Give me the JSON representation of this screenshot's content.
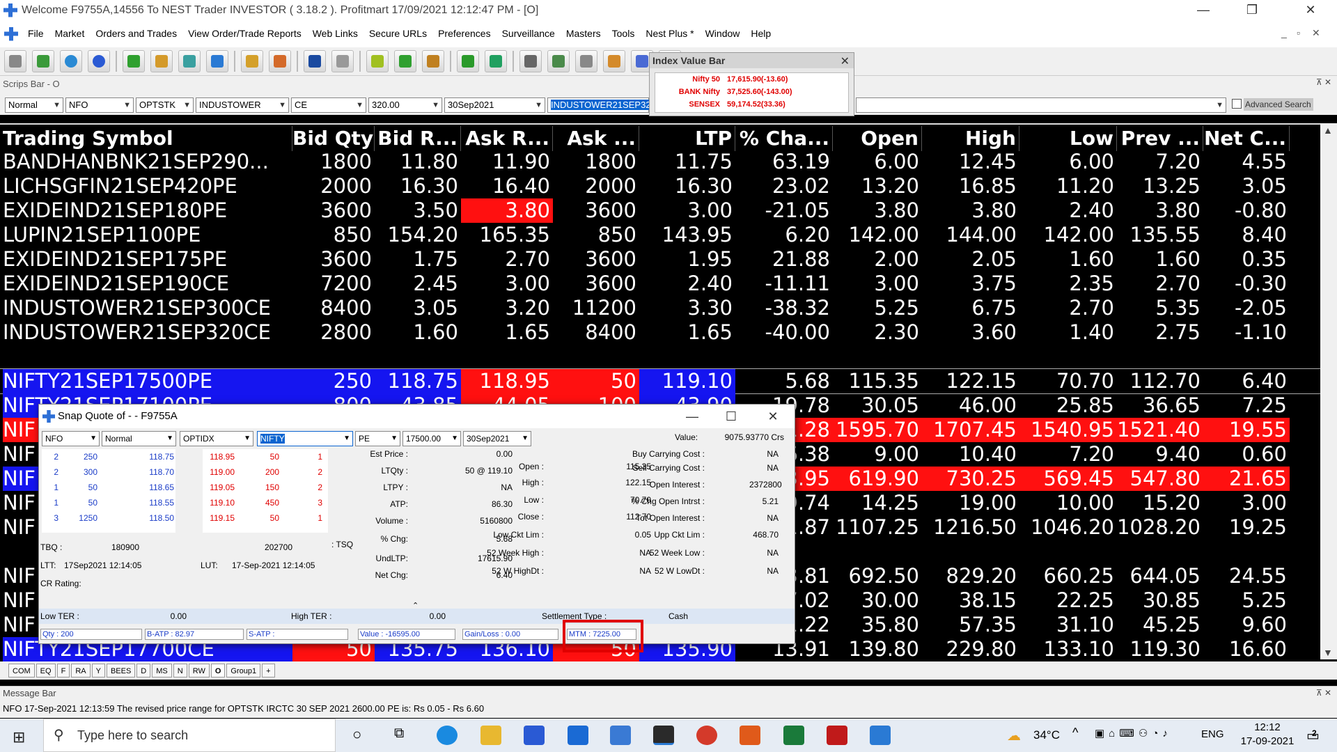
{
  "window": {
    "title": "Welcome F9755A,14556 To NEST Trader INVESTOR ( 3.18.2 ).  Profitmart  17/09/2021 12:12:47 PM - [O]",
    "minimize": "—",
    "restore": "❐",
    "close": "✕"
  },
  "menu": [
    "File",
    "Market",
    "Orders and Trades",
    "View Order/Trade Reports",
    "Web Links",
    "Secure URLs",
    "Preferences",
    "Surveillance",
    "Masters",
    "Tools",
    "Nest Plus *",
    "Window",
    "Help"
  ],
  "mdi_controls": {
    "minimize": "_",
    "restore": "▫",
    "close": "✕"
  },
  "index_value_bar": {
    "title": "Index Value Bar",
    "close": "✕",
    "rows": [
      {
        "name": "Nifty 50",
        "value": "17,615.90(-13.60)"
      },
      {
        "name": "BANK Nifty",
        "value": "37,525.60(-143.00)"
      },
      {
        "name": "SENSEX",
        "value": "59,174.52(33.36)"
      }
    ]
  },
  "scrips_bar": {
    "label": "Scrips Bar - O",
    "pin": "⊼ ✕",
    "fields": [
      "Normal",
      "NFO",
      "OPTSTK",
      "INDUSTOWER",
      "CE",
      "320.00",
      "30Sep2021",
      "INDUSTOWER21SEP320C",
      ""
    ],
    "advanced_search": "Advanced Search"
  },
  "grid": {
    "headers": [
      "Trading Symbol",
      "Bid Qty",
      "Bid R...",
      "Ask R...",
      "Ask ...",
      "LTP",
      "% Cha...",
      "Open",
      "High",
      "Low",
      "Prev ...",
      "Net C..."
    ],
    "rows": [
      [
        "BANDHANBNK21SEP290...",
        "1800",
        "11.80",
        "11.90",
        "1800",
        "11.75",
        "63.19",
        "6.00",
        "12.45",
        "6.00",
        "7.20",
        "4.55"
      ],
      [
        "LICHSGFIN21SEP420PE",
        "2000",
        "16.30",
        "16.40",
        "2000",
        "16.30",
        "23.02",
        "13.20",
        "16.85",
        "11.20",
        "13.25",
        "3.05"
      ],
      [
        "EXIDEIND21SEP180PE",
        "3600",
        "3.50",
        "3.80",
        "3600",
        "3.00",
        "-21.05",
        "3.80",
        "3.80",
        "2.40",
        "3.80",
        "-0.80"
      ],
      [
        "LUPIN21SEP1100PE",
        "850",
        "154.20",
        "165.35",
        "850",
        "143.95",
        "6.20",
        "142.00",
        "144.00",
        "142.00",
        "135.55",
        "8.40"
      ],
      [
        "EXIDEIND21SEP175PE",
        "3600",
        "1.75",
        "2.70",
        "3600",
        "1.95",
        "21.88",
        "2.00",
        "2.05",
        "1.60",
        "1.60",
        "0.35"
      ],
      [
        "EXIDEIND21SEP190CE",
        "7200",
        "2.45",
        "3.00",
        "3600",
        "2.40",
        "-11.11",
        "3.00",
        "3.75",
        "2.35",
        "2.70",
        "-0.30"
      ],
      [
        "INDUSTOWER21SEP300CE",
        "8400",
        "3.05",
        "3.20",
        "11200",
        "3.30",
        "-38.32",
        "5.25",
        "6.75",
        "2.70",
        "5.35",
        "-2.05"
      ],
      [
        "INDUSTOWER21SEP320CE",
        "2800",
        "1.60",
        "1.65",
        "8400",
        "1.65",
        "-40.00",
        "2.30",
        "3.60",
        "1.40",
        "2.75",
        "-1.10"
      ],
      [
        "",
        "",
        "",
        "",
        "",
        "",
        "",
        "",
        "",
        "",
        "",
        ""
      ],
      [
        "NIFTY21SEP17500PE",
        "250",
        "118.75",
        "118.95",
        "50",
        "119.10",
        "5.68",
        "115.35",
        "122.15",
        "70.70",
        "112.70",
        "6.40"
      ],
      [
        "NIFTY21SEP17100PE",
        "800",
        "43.85",
        "44.05",
        "100",
        "43.90",
        "19.78",
        "30.05",
        "46.00",
        "25.85",
        "36.65",
        "7.25"
      ],
      [
        "NIF",
        "",
        "",
        "",
        "",
        "",
        "1.28",
        "1595.70",
        "1707.45",
        "1540.95",
        "1521.40",
        "19.55"
      ],
      [
        "NIF",
        "",
        "",
        "",
        "",
        "",
        "6.38",
        "9.00",
        "10.40",
        "7.20",
        "9.40",
        "0.60"
      ],
      [
        "NIF",
        "",
        "",
        "",
        "",
        "",
        "3.95",
        "619.90",
        "730.25",
        "569.45",
        "547.80",
        "21.65"
      ],
      [
        "NIF",
        "",
        "",
        "",
        "",
        "",
        "9.74",
        "14.25",
        "19.00",
        "10.00",
        "15.20",
        "3.00"
      ],
      [
        "NIF",
        "",
        "",
        "",
        "",
        "",
        "1.87",
        "1107.25",
        "1216.50",
        "1046.20",
        "1028.20",
        "19.25"
      ],
      [
        "",
        "",
        "",
        "",
        "",
        "",
        "",
        "",
        "",
        "",
        "",
        ""
      ],
      [
        "NIF",
        "",
        "",
        "",
        "",
        "",
        "3.81",
        "692.50",
        "829.20",
        "660.25",
        "644.05",
        "24.55"
      ],
      [
        "NIF",
        "",
        "",
        "",
        "",
        "",
        "7.02",
        "30.00",
        "38.15",
        "22.25",
        "30.85",
        "5.25"
      ],
      [
        "NIF",
        "",
        "",
        "",
        "",
        "",
        "1.22",
        "35.80",
        "57.35",
        "31.10",
        "45.25",
        "9.60"
      ],
      [
        "NIFTY21SEP17700CE",
        "50",
        "135.75",
        "136.10",
        "50",
        "135.90",
        "13.91",
        "139.80",
        "229.80",
        "133.10",
        "119.30",
        "16.60"
      ]
    ],
    "colors": {
      "blue": "#1515f0",
      "red": "#ff1010",
      "white": "#ffffff"
    }
  },
  "tabs": [
    "COM",
    "EQ",
    "F",
    "RA",
    "Y",
    "BEES",
    "D",
    "MS",
    "N",
    "RW",
    "O",
    "Group1",
    "+"
  ],
  "message_bar": {
    "label": "Message Bar",
    "text": "NFO 17-Sep-2021 12:13:59 The revised price range for OPTSTK IRCTC 30 SEP 2021 2600.00 PE is: Rs 0.05 - Rs 6.60"
  },
  "snap_quote": {
    "title": "Snap Quote of  -  - F9755A",
    "minimize": "—",
    "maximize": "☐",
    "close": "✕",
    "selectors": [
      "NFO",
      "Normal",
      "OPTIDX",
      "NIFTY",
      "PE",
      "17500.00",
      "30Sep2021"
    ],
    "value_label": "Value:",
    "value": "9075.93770 Crs",
    "bid_depth": [
      [
        "2",
        "250",
        "118.75"
      ],
      [
        "2",
        "300",
        "118.70"
      ],
      [
        "1",
        "50",
        "118.65"
      ],
      [
        "1",
        "50",
        "118.55"
      ],
      [
        "3",
        "1250",
        "118.50"
      ]
    ],
    "ask_depth": [
      [
        "118.95",
        "50",
        "1"
      ],
      [
        "119.00",
        "200",
        "2"
      ],
      [
        "119.05",
        "150",
        "2"
      ],
      [
        "119.10",
        "450",
        "3"
      ],
      [
        "119.15",
        "50",
        "1"
      ]
    ],
    "tbq_label": "TBQ :",
    "tbq": "180900",
    "tsq": "202700",
    "tsq_label": ": TSQ",
    "ltt_label": "LTT:",
    "ltt": "17Sep2021 12:14:05",
    "lut_label": "LUT:",
    "lut": "17-Sep-2021 12:14:05",
    "cr_rating_label": "CR Rating:",
    "left_stats": [
      [
        "Est Price :",
        "0.00"
      ],
      [
        "LTQty :",
        "50 @ 119.10"
      ],
      [
        "LTPY :",
        "NA"
      ],
      [
        "ATP:",
        "86.30"
      ],
      [
        "Volume :",
        "5160800"
      ],
      [
        "% Chg:",
        "5.68"
      ],
      [
        "UndLTP:",
        "17615.90"
      ],
      [
        "Net Chg:",
        "6.40"
      ]
    ],
    "mid_stats": [
      [
        "Open :",
        "115.35"
      ],
      [
        "High :",
        "122.15"
      ],
      [
        "Low :",
        "70.70"
      ],
      [
        "Close :",
        "112.70"
      ],
      [
        "Low Ckt Lim :",
        "0.05"
      ],
      [
        "52 Week High :",
        "NA"
      ],
      [
        "52 W HighDt :",
        "NA"
      ]
    ],
    "right_stats": [
      [
        "Buy Carrying Cost :",
        "NA"
      ],
      [
        "Sell Carrying Cost :",
        "NA"
      ],
      [
        "Open Interest :",
        "2372800"
      ],
      [
        "% Chg Open Intrst :",
        "5.21"
      ],
      [
        "Tot Open Interest :",
        "NA"
      ],
      [
        "Upp Ckt Lim :",
        "468.70"
      ],
      [
        "52 Week Low :",
        "NA"
      ],
      [
        "52 W LowDt :",
        "NA"
      ]
    ],
    "low_ter_label": "Low TER :",
    "low_ter": "0.00",
    "high_ter_label": "High TER :",
    "high_ter": "0.00",
    "settlement_label": "Settlement Type :",
    "settlement": "Cash",
    "footer": [
      "Qty : 200",
      "B-ATP : 82.97",
      "S-ATP :",
      "Value : -16595.00",
      "Gain/Loss : 0.00",
      "MTM : 7225.00"
    ]
  },
  "taskbar": {
    "search_placeholder": "Type here to search",
    "weather": "34°C",
    "lang": "ENG",
    "time": "12:12",
    "date": "17-09-2021",
    "notifications": "2"
  }
}
